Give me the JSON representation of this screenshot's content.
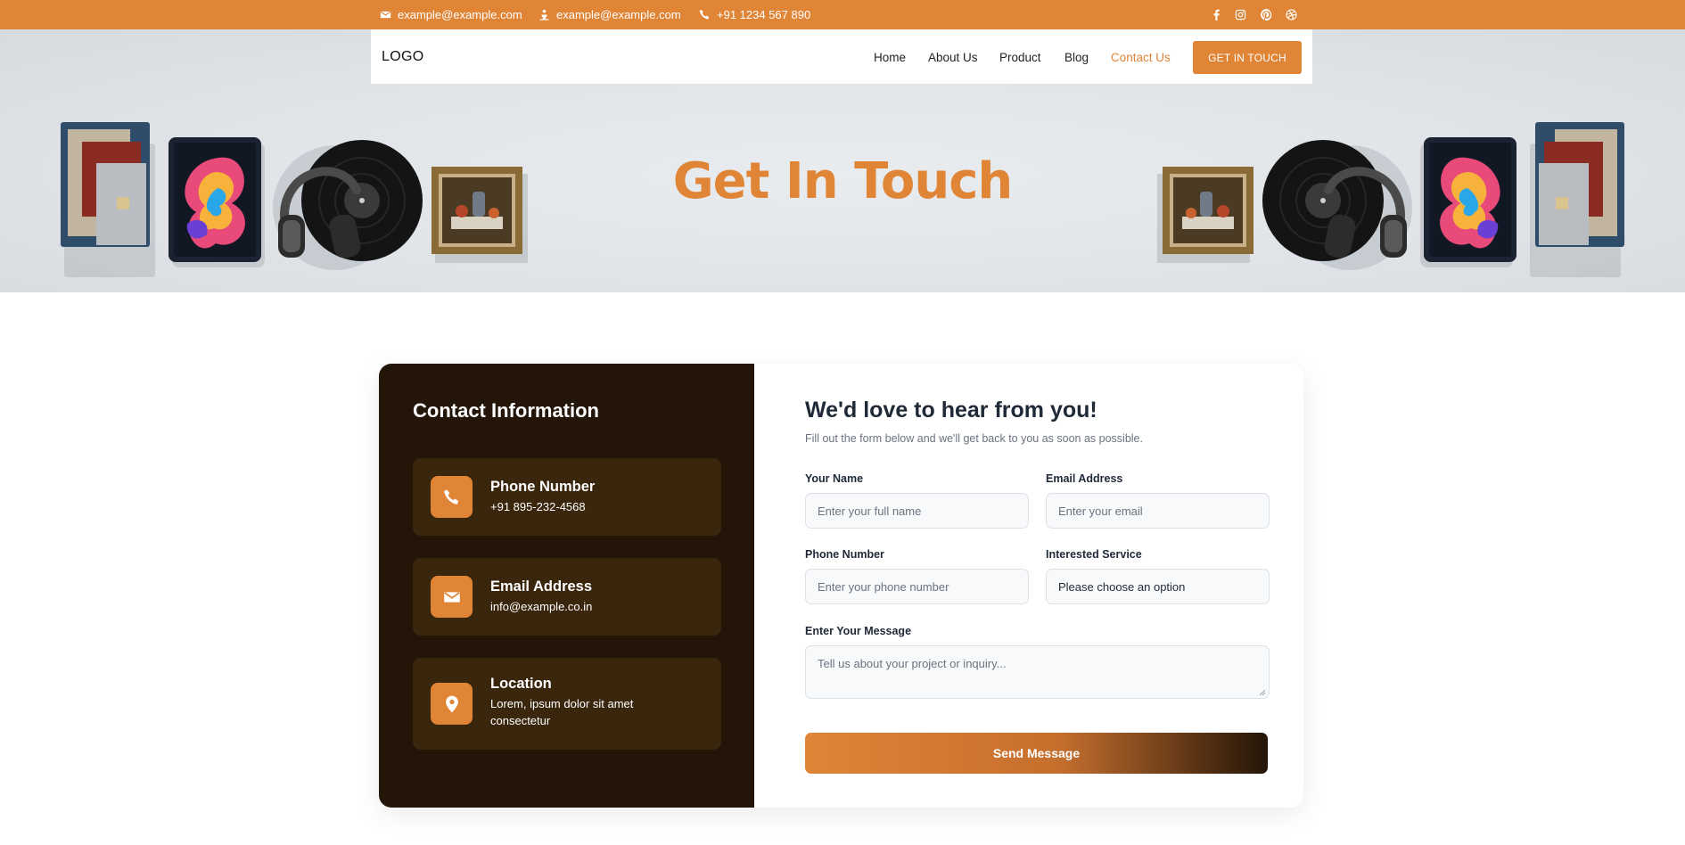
{
  "topbar": {
    "email_1": "example@example.com",
    "email_2": "example@example.com",
    "phone": "+91 1234 567 890",
    "socials": [
      "facebook-icon",
      "instagram-icon",
      "pinterest-icon",
      "dribbble-icon"
    ]
  },
  "nav": {
    "logo": "LOGO",
    "links": [
      "Home",
      "About Us",
      "Product",
      "Blog",
      "Contact Us"
    ],
    "active": "Contact Us",
    "cta": "GET IN TOUCH"
  },
  "hero": {
    "title": "Get In Touch"
  },
  "contact_info": {
    "title": "Contact Information",
    "items": [
      {
        "icon": "phone-icon",
        "label": "Phone Number",
        "value": "+91 895-232-4568"
      },
      {
        "icon": "envelope-icon",
        "label": "Email Address",
        "value": "info@example.co.in"
      },
      {
        "icon": "location-pin-icon",
        "label": "Location",
        "value": "Lorem, ipsum dolor sit amet consectetur"
      }
    ]
  },
  "form": {
    "title": "We'd love to hear from you!",
    "subtitle": "Fill out the form below and we'll get back to you as soon as possible.",
    "name_label": "Your Name",
    "name_placeholder": "Enter your full name",
    "email_label": "Email Address",
    "email_placeholder": "Enter your email",
    "phone_label": "Phone Number",
    "phone_placeholder": "Enter your phone number",
    "service_label": "Interested Service",
    "service_value": "Please choose an option",
    "message_label": "Enter Your Message",
    "message_placeholder": "Tell us about your project or inquiry...",
    "submit": "Send Message"
  },
  "colors": {
    "accent": "#e08436",
    "dark_panel": "#231507",
    "info_card": "#3a250d"
  }
}
